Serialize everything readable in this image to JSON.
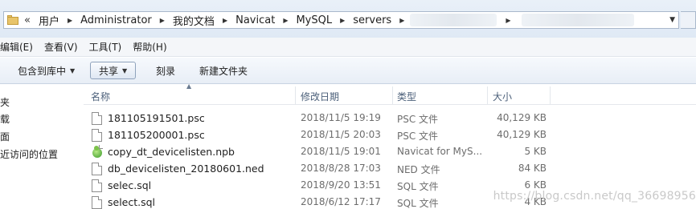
{
  "address": {
    "breadcrumbs": [
      "用户",
      "Administrator",
      "我的文档",
      "Navicat",
      "MySQL",
      "servers"
    ],
    "overflow_glyph": "«",
    "separator": "▶",
    "dropdown_glyph": "▼"
  },
  "menu": [
    "编辑(E)",
    "查看(V)",
    "工具(T)",
    "帮助(H)"
  ],
  "toolbar": {
    "include_library": "包含到库中",
    "share": "共享",
    "burn": "刻录",
    "new_folder": "新建文件夹"
  },
  "nav": [
    "夹",
    "载",
    "面",
    "近访问的位置"
  ],
  "columns": {
    "name": "名称",
    "modified": "修改日期",
    "type": "类型",
    "size": "大小"
  },
  "files": [
    {
      "name": "181105191501.psc",
      "date": "2018/11/5 19:19",
      "type": "PSC 文件",
      "size": "40,129 KB",
      "icon": "file-icon"
    },
    {
      "name": "181105200001.psc",
      "date": "2018/11/5 20:03",
      "type": "PSC 文件",
      "size": "40,129 KB",
      "icon": "file-icon"
    },
    {
      "name": "copy_dt_devicelisten.npb",
      "date": "2018/11/5 19:01",
      "type": "Navicat for MyS...",
      "size": "5 KB",
      "icon": "navicat-icon"
    },
    {
      "name": "db_devicelisten_20180601.ned",
      "date": "2018/8/28 17:03",
      "type": "NED 文件",
      "size": "84 KB",
      "icon": "file-icon"
    },
    {
      "name": "selec.sql",
      "date": "2018/9/20 13:51",
      "type": "SQL 文件",
      "size": "6 KB",
      "icon": "file-icon"
    },
    {
      "name": "select.sql",
      "date": "2018/6/12 17:17",
      "type": "SQL 文件",
      "size": "4 KB",
      "icon": "file-icon"
    }
  ],
  "watermark": "https://blog.csdn.net/qq_36698956"
}
